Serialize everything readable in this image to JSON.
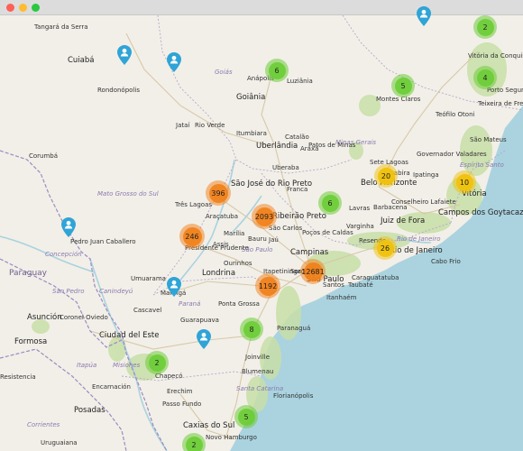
{
  "colors": {
    "land": "#f2efe8",
    "sea": "#aad3df",
    "forest": "#c8dfa8",
    "border_country": "#9b8bc2",
    "border_state": "#b4a8cf",
    "road": "#d7c9a8",
    "cluster_small": "#6ecc39",
    "cluster_medium": "#f0c20c",
    "cluster_large": "#f18017",
    "pin": "#2fa4d7"
  },
  "window": {
    "controls": [
      "close",
      "minimize",
      "maximize"
    ]
  },
  "clusters": [
    {
      "id": "c1",
      "count": "2",
      "size": "small"
    },
    {
      "id": "c2",
      "count": "6",
      "size": "small"
    },
    {
      "id": "c3",
      "count": "4",
      "size": "small"
    },
    {
      "id": "c4",
      "count": "5",
      "size": "small"
    },
    {
      "id": "c5",
      "count": "396",
      "size": "large"
    },
    {
      "id": "c6",
      "count": "2093",
      "size": "large"
    },
    {
      "id": "c7",
      "count": "6",
      "size": "small"
    },
    {
      "id": "c8",
      "count": "20",
      "size": "medium"
    },
    {
      "id": "c9",
      "count": "10",
      "size": "medium"
    },
    {
      "id": "c10",
      "count": "246",
      "size": "large"
    },
    {
      "id": "c11",
      "count": "26",
      "size": "medium"
    },
    {
      "id": "c12",
      "count": "12681",
      "size": "large"
    },
    {
      "id": "c13",
      "count": "1192",
      "size": "large"
    },
    {
      "id": "c14",
      "count": "8",
      "size": "small"
    },
    {
      "id": "c15",
      "count": "2",
      "size": "small"
    },
    {
      "id": "c16",
      "count": "5",
      "size": "small"
    },
    {
      "id": "c17",
      "count": "2",
      "size": "small"
    }
  ],
  "pins": [
    {
      "id": "p1",
      "icon": "user-icon"
    },
    {
      "id": "p2",
      "icon": "user-icon"
    },
    {
      "id": "p3",
      "icon": "user-icon"
    },
    {
      "id": "p4",
      "icon": "user-icon"
    },
    {
      "id": "p5",
      "icon": "user-icon"
    },
    {
      "id": "p6",
      "icon": "user-icon"
    }
  ],
  "labels": {
    "countries": [
      "Paraguay"
    ],
    "regions": [
      "Goiás",
      "Minas Gerais",
      "Mato Grosso do Sul",
      "Espírito Santo",
      "São Paulo",
      "Paraná",
      "Rio de Janeiro",
      "Santa Catarina",
      "Misiones",
      "Corrientes",
      "Itapúa",
      "Concepción",
      "San Pedro",
      "Canindeyú"
    ],
    "cities": [
      "Tangará da Serra",
      "Cuiabá",
      "Rondonópolis",
      "Jataí",
      "Rio Verde",
      "Anápolis",
      "Luziânia",
      "Goiânia",
      "Itumbiara",
      "Uberlândia",
      "Catalão",
      "Patos de Minas",
      "Uberaba",
      "Araxá",
      "São José do Rio Preto",
      "Franca",
      "Três Lagoas",
      "Araçatuba",
      "Ribeirão Preto",
      "São Carlos",
      "Poços de Caldas",
      "Marília",
      "Bauru",
      "Jaú",
      "Presidente Prudente",
      "Assis",
      "Ourinhos",
      "Campinas",
      "Sorocaba",
      "Itapetininga",
      "Londrina",
      "Umuarama",
      "Maringá",
      "Cascavel",
      "Ponta Grossa",
      "Guarapuava",
      "Paranaguá",
      "Joinville",
      "Blumenau",
      "Florianópolis",
      "Chapecó",
      "Erechim",
      "Passo Fundo",
      "Caxias do Sul",
      "Novo Hamburgo",
      "Uruguaiana",
      "Corumbá",
      "Pedro Juan Caballero",
      "Asunción",
      "Coronel Oviedo",
      "Ciudad del Este",
      "Encarnación",
      "Posadas",
      "Formosa",
      "Resistencia",
      "Belo Horizonte",
      "Sete Lagoas",
      "Lavras",
      "Varginha",
      "Juiz de Fora",
      "Barbacena",
      "Conselheiro Lafaiete",
      "Governador Valadares",
      "Ipatinga",
      "Montes Claros",
      "Teófilo Otoni",
      "Teixeira de Freitas",
      "Porto Seguro",
      "Vitória da Conquista",
      "São Mateus",
      "Vitória",
      "Campos dos Goytacazes",
      "Rio de Janeiro",
      "Cabo Frio",
      "Taubaté",
      "Caraguatatuba",
      "Itanhaém",
      "Resende",
      "Santos",
      "São Paulo",
      "Itabira"
    ]
  }
}
